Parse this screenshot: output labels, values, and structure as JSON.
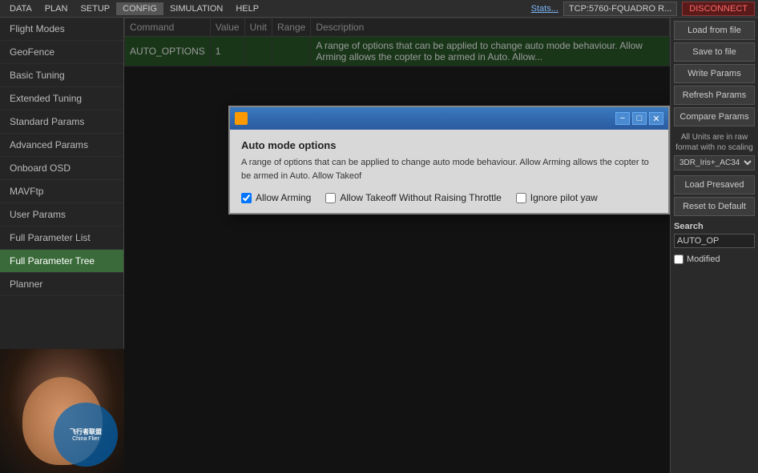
{
  "menubar": {
    "items": [
      "DATA",
      "PLAN",
      "SETUP",
      "CONFIG",
      "SIMULATION",
      "HELP"
    ],
    "active": "CONFIG",
    "stats_link": "Stats...",
    "connection_info": "TCP:5760-FQUADRO R...",
    "disconnect_label": "DISCONNECT"
  },
  "sidebar": {
    "items": [
      {
        "id": "flight-modes",
        "label": "Flight Modes"
      },
      {
        "id": "geofence",
        "label": "GeoFence"
      },
      {
        "id": "basic-tuning",
        "label": "Basic Tuning"
      },
      {
        "id": "extended-tuning",
        "label": "Extended Tuning"
      },
      {
        "id": "standard-params",
        "label": "Standard Params"
      },
      {
        "id": "advanced-params",
        "label": "Advanced Params"
      },
      {
        "id": "onboard-osd",
        "label": "Onboard OSD"
      },
      {
        "id": "mavftp",
        "label": "MAVFtp"
      },
      {
        "id": "user-params",
        "label": "User Params"
      },
      {
        "id": "full-param-list",
        "label": "Full Parameter List"
      },
      {
        "id": "full-param-tree",
        "label": "Full Parameter Tree",
        "active": true
      },
      {
        "id": "planner",
        "label": "Planner"
      }
    ]
  },
  "table": {
    "headers": [
      "Command",
      "Value",
      "Unit",
      "Range",
      "Description"
    ],
    "rows": [
      {
        "command": "AUTO_OPTIONS",
        "value": "1",
        "unit": "",
        "range": "",
        "description": "A range of options that can be applied to change auto mode behaviour. Allow Arming allows the copter to be armed in Auto. Allow...",
        "selected": true
      }
    ]
  },
  "dialog": {
    "title": "",
    "heading": "Auto mode options",
    "description": "A range of options that can be applied to change auto mode behaviour. Allow Arming allows the copter to be armed in Auto. Allow Takeof",
    "options": [
      {
        "id": "allow-arming",
        "label": "Allow Arming",
        "checked": true
      },
      {
        "id": "allow-takeoff",
        "label": "Allow Takeoff Without Raising Throttle",
        "checked": false
      },
      {
        "id": "ignore-pilot-yaw",
        "label": "Ignore pilot yaw",
        "checked": false
      }
    ],
    "controls": [
      "−",
      "□",
      "✕"
    ]
  },
  "right_panel": {
    "load_from_file": "Load from file",
    "save_to_file": "Save to file",
    "write_params": "Write Params",
    "refresh_params": "Refresh Params",
    "compare_params": "Compare Params",
    "units_label": "All Units are in raw\nformat with no scaling",
    "dropdown_value": "3DR_Iris+_AC34...",
    "load_presaved": "Load Presaved",
    "reset_to_default": "Reset to Default",
    "search_label": "Search",
    "search_value": "AUTO_OP",
    "modified_label": "Modified"
  },
  "watermark": {
    "line1": "飞行者联盟",
    "line2": "China Flier"
  }
}
